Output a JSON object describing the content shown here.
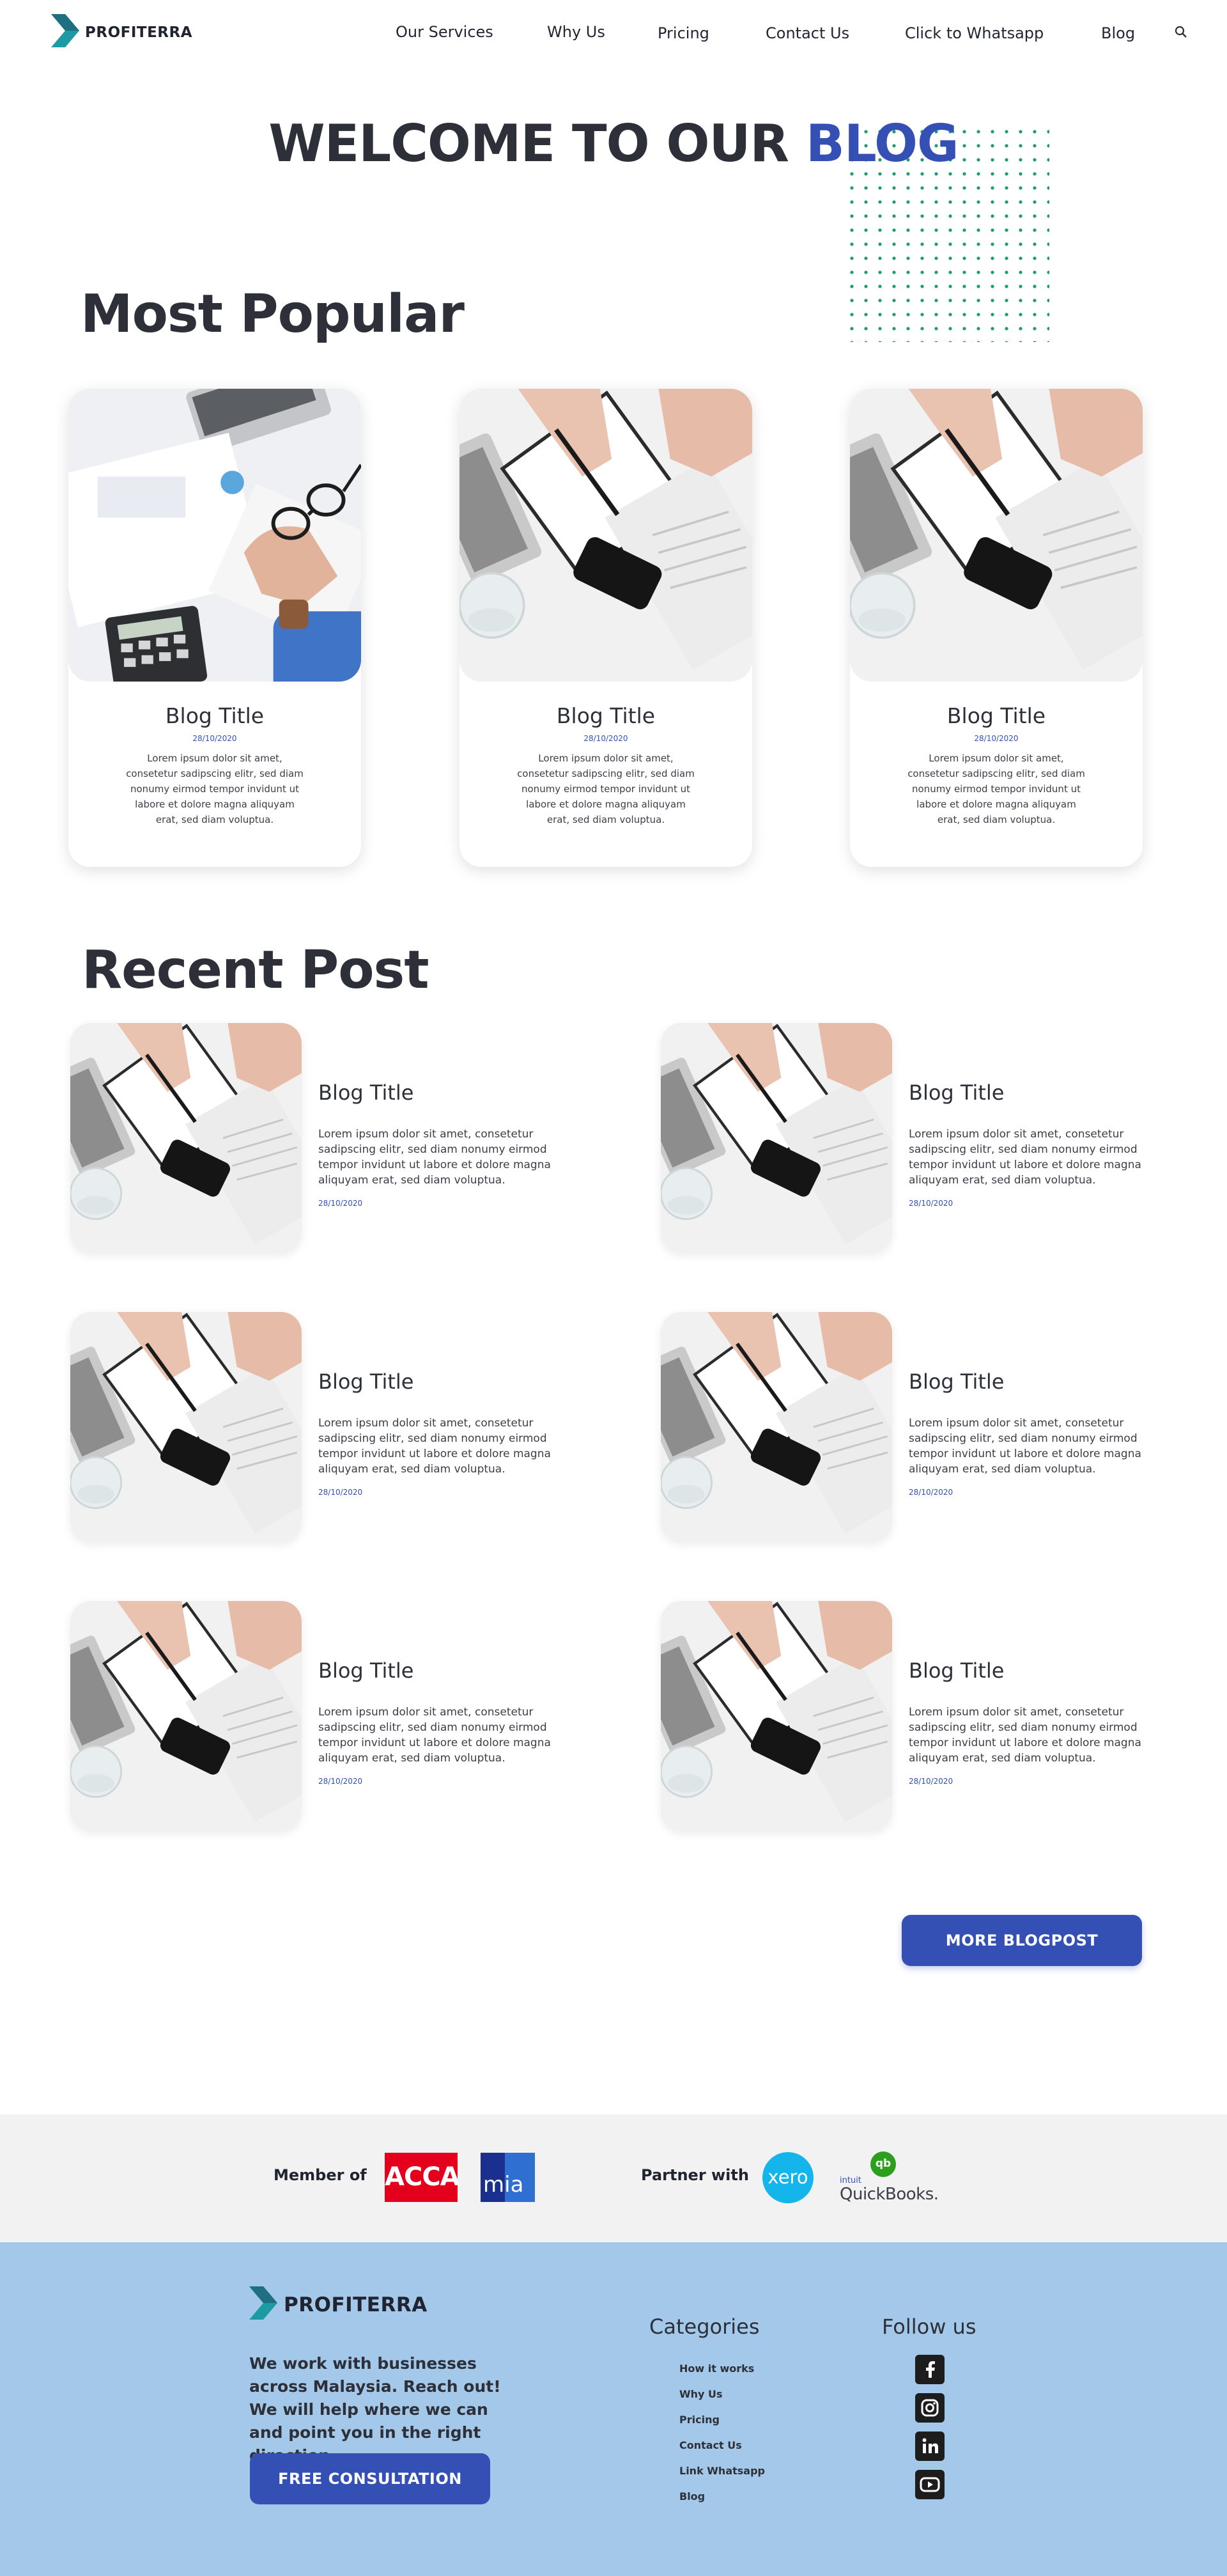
{
  "header": {
    "brand": "PROFITERRA",
    "nav": [
      "Our Services",
      "Why Us",
      "Pricing",
      "Contact Us",
      "Click to Whatsapp",
      "Blog"
    ]
  },
  "hero": {
    "title_main": "WELCOME TO OUR",
    "title_accent": "BLOG"
  },
  "popular": {
    "heading": "Most Popular",
    "cards": [
      {
        "title": "Blog Title",
        "date": "28/10/2020",
        "text": "Lorem ipsum dolor sit amet, consetetur sadipscing elitr, sed diam nonumy eirmod tempor invidunt ut labore et dolore magna aliquyam erat, sed diam voluptua."
      },
      {
        "title": "Blog Title",
        "date": "28/10/2020",
        "text": "Lorem ipsum dolor sit amet, consetetur sadipscing elitr, sed diam nonumy eirmod tempor invidunt ut labore et dolore magna aliquyam erat, sed diam voluptua."
      },
      {
        "title": "Blog Title",
        "date": "28/10/2020",
        "text": "Lorem ipsum dolor sit amet, consetetur sadipscing elitr, sed diam nonumy eirmod tempor invidunt ut labore et dolore magna aliquyam erat, sed diam voluptua."
      }
    ]
  },
  "recent": {
    "heading": "Recent Post",
    "posts": [
      {
        "title": "Blog Title",
        "text": "Lorem ipsum dolor sit amet, consetetur sadipscing elitr, sed diam nonumy eirmod tempor invidunt ut labore et dolore magna aliquyam erat, sed diam voluptua.",
        "date": "28/10/2020"
      },
      {
        "title": "Blog Title",
        "text": "Lorem ipsum dolor sit amet, consetetur sadipscing elitr, sed diam nonumy eirmod tempor invidunt ut labore et dolore magna aliquyam erat, sed diam voluptua.",
        "date": "28/10/2020"
      },
      {
        "title": "Blog Title",
        "text": "Lorem ipsum dolor sit amet, consetetur sadipscing elitr, sed diam nonumy eirmod tempor invidunt ut labore et dolore magna aliquyam erat, sed diam voluptua.",
        "date": "28/10/2020"
      },
      {
        "title": "Blog Title",
        "text": "Lorem ipsum dolor sit amet, consetetur sadipscing elitr, sed diam nonumy eirmod tempor invidunt ut labore et dolore magna aliquyam erat, sed diam voluptua.",
        "date": "28/10/2020"
      },
      {
        "title": "Blog Title",
        "text": "Lorem ipsum dolor sit amet, consetetur sadipscing elitr, sed diam nonumy eirmod tempor invidunt ut labore et dolore magna aliquyam erat, sed diam voluptua.",
        "date": "28/10/2020"
      },
      {
        "title": "Blog Title",
        "text": "Lorem ipsum dolor sit amet, consetetur sadipscing elitr, sed diam nonumy eirmod tempor invidunt ut labore et dolore magna aliquyam erat, sed diam voluptua.",
        "date": "28/10/2020"
      }
    ],
    "more_button": "MORE BLOGPOST"
  },
  "members": {
    "member_label": "Member of",
    "partner_label": "Partner with",
    "acca": "ACCA",
    "mia": "mia",
    "xero": "xero",
    "qb_prefix": "intuit",
    "qb_name": "QuickBooks.",
    "qb_badge": "qb"
  },
  "footer": {
    "brand": "PROFITERRA",
    "tagline": "We work with businesses across Malaysia. Reach out! We will help where we can and point you in the right direction.",
    "consult_button": "FREE CONSULTATION",
    "categories_heading": "Categories",
    "categories": [
      "How it works",
      "Why Us",
      "Pricing",
      "Contact Us",
      "Link Whatsapp",
      "Blog"
    ],
    "follow_heading": "Follow us",
    "social_icons": [
      "facebook-icon",
      "instagram-icon",
      "linkedin-icon",
      "youtube-icon"
    ]
  },
  "colors": {
    "accent": "#3450b4",
    "dots": "#1e9a74",
    "footer_bg": "#a3c8e9",
    "band_bg": "#f2f2f2",
    "acca_red": "#e4001c",
    "mia_blue": "#1b2f8f",
    "xero_blue": "#13b5ea",
    "qb_green": "#2ca01c"
  }
}
